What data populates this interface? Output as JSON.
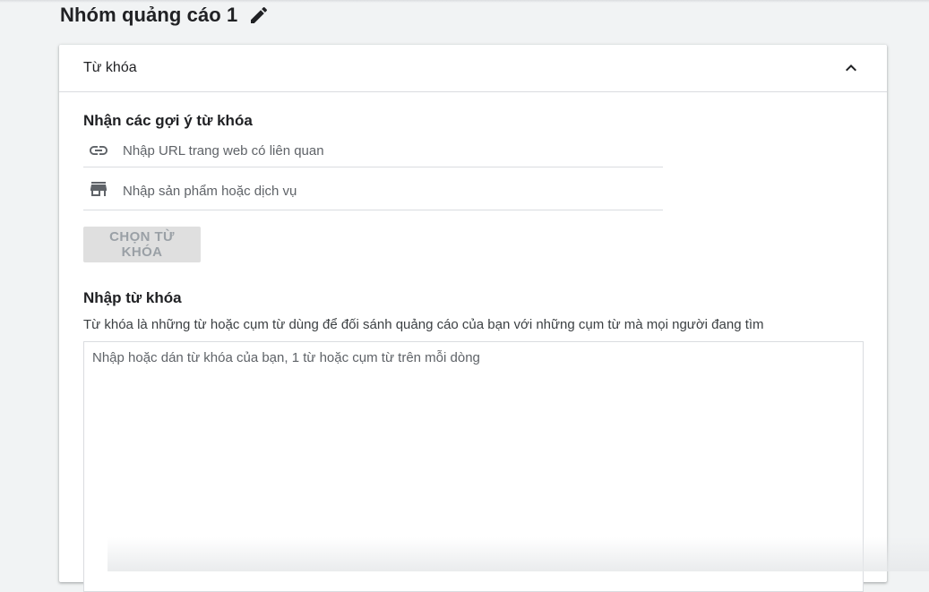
{
  "header": {
    "title": "Nhóm quảng cáo 1",
    "edit_icon": "pencil-icon"
  },
  "card": {
    "title": "Từ khóa",
    "collapse_icon": "chevron-up-icon"
  },
  "suggestions": {
    "title": "Nhận các gợi ý từ khóa",
    "url_icon": "link-icon",
    "url_placeholder": "Nhập URL trang web có liên quan",
    "url_value": "",
    "product_icon": "store-icon",
    "product_placeholder": "Nhập sản phẩm hoặc dịch vụ",
    "product_value": "",
    "choose_button_label": "CHỌN TỪ KHÓA"
  },
  "keywords": {
    "title": "Nhập từ khóa",
    "description": "Từ khóa là những từ hoặc cụm từ dùng để đối sánh quảng cáo của bạn với những cụm từ mà mọi người đang tìm",
    "placeholder": "Nhập hoặc dán từ khóa của bạn, 1 từ hoặc cụm từ trên mỗi dòng",
    "value": ""
  },
  "colors": {
    "background": "#f1f3f4",
    "card": "#ffffff",
    "text_primary": "#202124",
    "text_secondary": "#5f6368",
    "divider": "#dadce0",
    "disabled_button_bg": "#dfdfdf",
    "disabled_button_text": "#9aa0a6"
  }
}
